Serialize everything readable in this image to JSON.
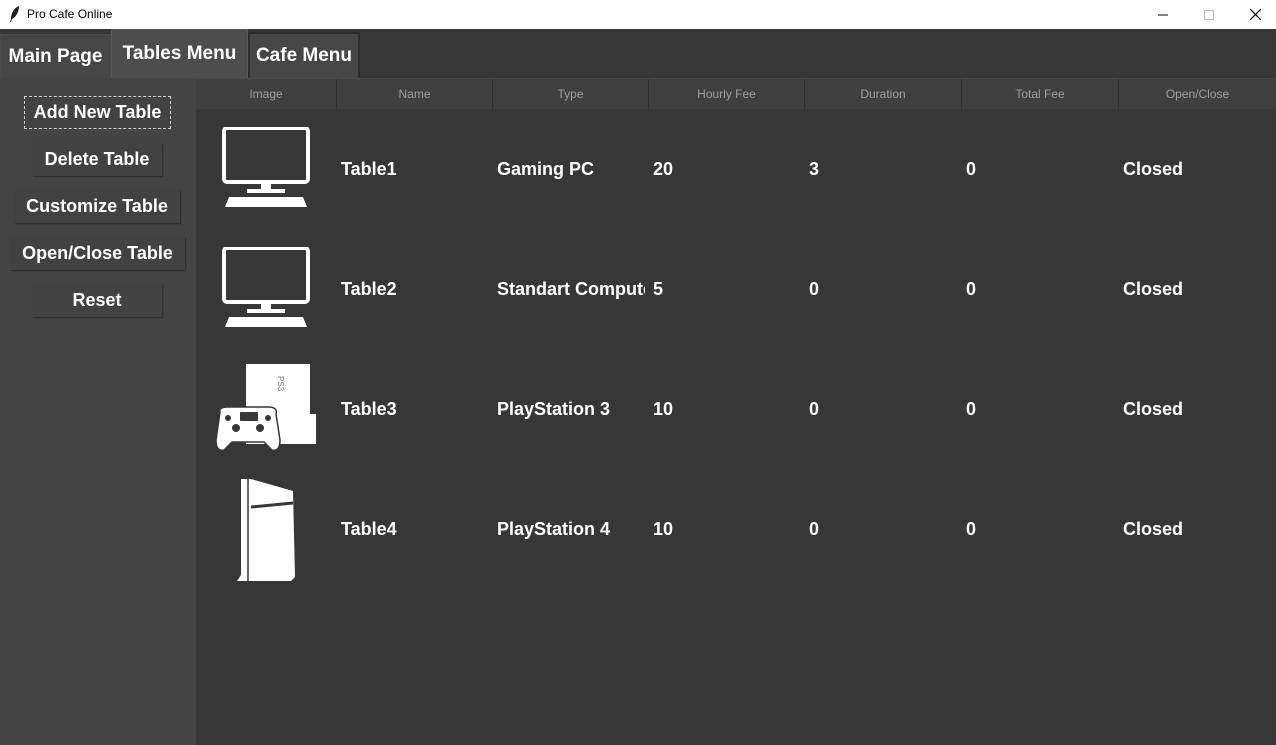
{
  "window": {
    "title": "Pro Cafe Online",
    "controls": {
      "minimize": "—",
      "maximize": "☐",
      "close": "✕"
    }
  },
  "tabs": [
    {
      "label": "Main Page"
    },
    {
      "label": "Tables Menu",
      "selected": true
    },
    {
      "label": "Cafe Menu"
    }
  ],
  "sidebar": {
    "buttons": [
      {
        "label": "Add New Table"
      },
      {
        "label": "Delete Table"
      },
      {
        "label": "Customize Table"
      },
      {
        "label": "Open/Close Table"
      },
      {
        "label": "Reset"
      }
    ]
  },
  "table": {
    "columns": [
      "Image",
      "Name",
      "Type",
      "Hourly Fee",
      "Duration",
      "Total Fee",
      "Open/Close"
    ],
    "rows": [
      {
        "icon": "monitor-icon",
        "name": "Table1",
        "type": "Gaming PC",
        "hourly_fee": "20",
        "duration": "3",
        "total_fee": "0",
        "status": "Closed"
      },
      {
        "icon": "monitor-icon",
        "name": "Table2",
        "type": "Standart Computer",
        "hourly_fee": "5",
        "duration": "0",
        "total_fee": "0",
        "status": "Closed"
      },
      {
        "icon": "ps3-console-icon",
        "name": "Table3",
        "type": "PlayStation 3",
        "hourly_fee": "10",
        "duration": "0",
        "total_fee": "0",
        "status": "Closed"
      },
      {
        "icon": "ps4-console-icon",
        "name": "Table4",
        "type": "PlayStation 4",
        "hourly_fee": "10",
        "duration": "0",
        "total_fee": "0",
        "status": "Closed"
      }
    ]
  },
  "colors": {
    "background": "#373737",
    "sidebar": "#444444",
    "text": "#ffffff",
    "header_text": "#9f9f9f"
  }
}
